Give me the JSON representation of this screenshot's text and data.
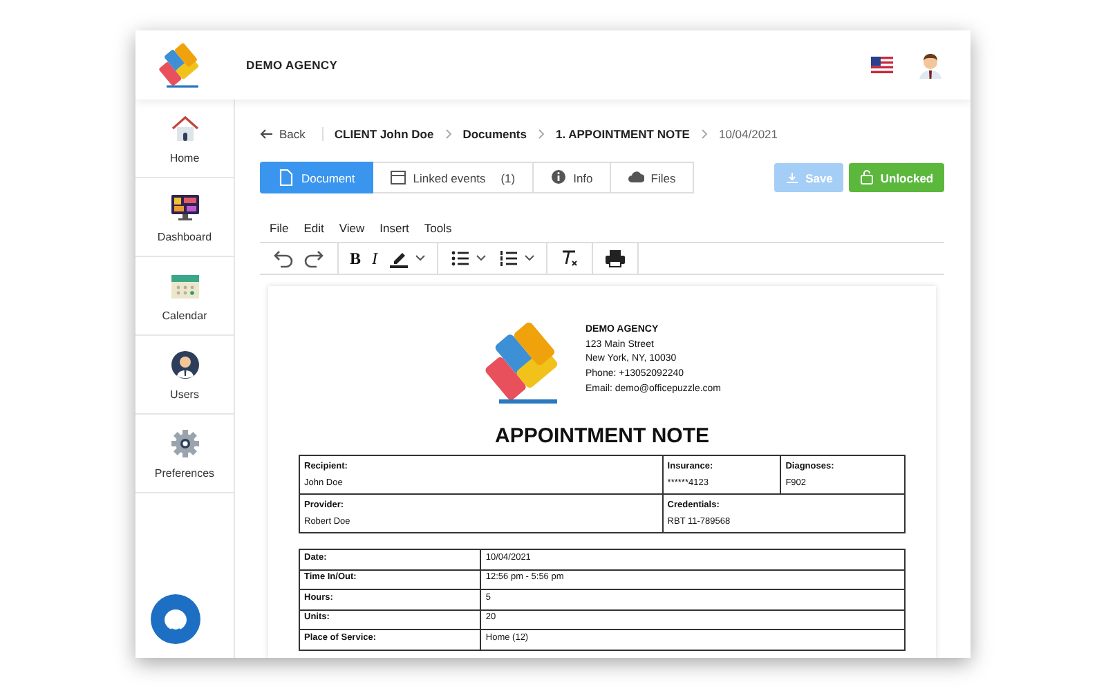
{
  "header": {
    "agency": "DEMO AGENCY"
  },
  "sidebar": {
    "items": [
      {
        "kind": "home",
        "label": "Home"
      },
      {
        "kind": "dashboard",
        "label": "Dashboard"
      },
      {
        "kind": "calendar",
        "label": "Calendar"
      },
      {
        "kind": "users",
        "label": "Users"
      },
      {
        "kind": "preferences",
        "label": "Preferences"
      }
    ]
  },
  "breadcrumb": {
    "back": "Back",
    "items": [
      {
        "kind": "link",
        "text": "CLIENT John Doe"
      },
      {
        "kind": "link",
        "text": "Documents"
      },
      {
        "kind": "link",
        "text": "1. APPOINTMENT NOTE"
      },
      {
        "kind": "date",
        "text": "10/04/2021"
      }
    ]
  },
  "tabs": [
    {
      "kind": "document",
      "label": "Document",
      "selected": true
    },
    {
      "kind": "events",
      "label": "Linked events",
      "count": "(1)",
      "selected": false
    },
    {
      "kind": "info",
      "label": "Info",
      "selected": false
    },
    {
      "kind": "files",
      "label": "Files",
      "selected": false
    }
  ],
  "actions": [
    {
      "kind": "save",
      "label": "Save",
      "disabled": true
    },
    {
      "kind": "unlock",
      "label": "Unlocked",
      "disabled": false
    }
  ],
  "editor": {
    "menu": [
      "File",
      "Edit",
      "View",
      "Insert",
      "Tools"
    ],
    "toolbar": [
      [
        {
          "kind": "undo"
        },
        {
          "kind": "redo"
        }
      ],
      [
        {
          "kind": "bold",
          "text": "B"
        },
        {
          "kind": "italic",
          "text": "I"
        },
        {
          "kind": "highlight"
        }
      ],
      [
        {
          "kind": "bullets"
        },
        {
          "kind": "numbers"
        }
      ],
      [
        {
          "kind": "clear"
        }
      ],
      [
        {
          "kind": "print"
        }
      ]
    ]
  },
  "document": {
    "letterhead": {
      "name": "DEMO AGENCY",
      "lines": [
        "123 Main Street",
        "New York, NY, 10030",
        "Phone: +13052092240",
        "Email: demo@officepuzzle.com"
      ]
    },
    "title": "APPOINTMENT NOTE",
    "parties": [
      [
        {
          "label": "Recipient:",
          "value": "John Doe"
        },
        {
          "label": "Insurance:",
          "value": "******4123"
        },
        {
          "label": "Diagnoses:",
          "value": "F902"
        }
      ],
      [
        {
          "label": "Provider:",
          "value": "Robert Doe"
        },
        {
          "label": "Credentials:",
          "value": "RBT 11-789568",
          "wide": true
        }
      ]
    ],
    "details": [
      {
        "label": "Date:",
        "value": "10/04/2021"
      },
      {
        "label": "Time In/Out:",
        "value": "12:56 pm - 5:56 pm"
      },
      {
        "label": "Hours:",
        "value": "5"
      },
      {
        "label": "Units:",
        "value": "20"
      },
      {
        "label": "Place of Service:",
        "value": "Home (12)"
      }
    ]
  }
}
